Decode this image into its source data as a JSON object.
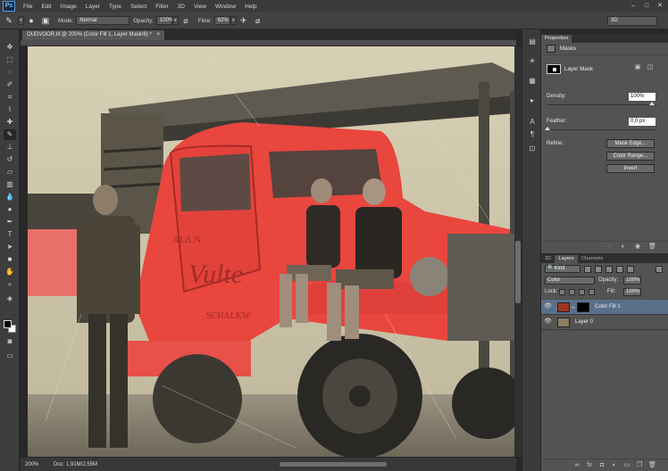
{
  "menubar": {
    "logo": "Ps",
    "items": [
      "File",
      "Edit",
      "Image",
      "Layer",
      "Type",
      "Select",
      "Filter",
      "3D",
      "View",
      "Window",
      "Help"
    ],
    "window_controls": [
      "–",
      "□",
      "✕"
    ]
  },
  "options_bar": {
    "mode_label": "Mode:",
    "mode_value": "Normal",
    "opacity_label": "Opacity:",
    "opacity_value": "100%",
    "flow_label": "Flow:",
    "flow_value": "62%",
    "workspace": "3D"
  },
  "document": {
    "tab_title": "OUDVOOR.tif @ 200% (Color Fill 1, Layer Mask/8) *",
    "tab_close": "×",
    "truck_lettering_1": "ΑΙ.Δ.Ν",
    "truck_lettering_2": "Vulte",
    "truck_lettering_3": "SCHALKW"
  },
  "status": {
    "zoom": "200%",
    "doc_info": "Doc: 1,91M/2,55M"
  },
  "properties_panel": {
    "tab": "Properties",
    "section": "Masks",
    "mask_type": "Layer Mask",
    "density_label": "Density:",
    "density_value": "100%",
    "feather_label": "Feather:",
    "feather_value": "0,0 px",
    "refine_label": "Refine:",
    "buttons": [
      "Mask Edge...",
      "Color Range...",
      "Invert"
    ]
  },
  "layers_panel": {
    "tabs": [
      "3D",
      "Layers",
      "Channels"
    ],
    "kind_filter": "Kind",
    "blend_mode": "Color",
    "opacity_label": "Opacity:",
    "opacity_value": "100%",
    "lock_label": "Lock:",
    "fill_label": "Fill:",
    "fill_value": "100%",
    "layers": [
      {
        "name": "Color Fill 1",
        "selected": true
      },
      {
        "name": "Layer 0",
        "selected": false
      }
    ]
  },
  "colors": {
    "fill_swatch": "#a0341f",
    "accent_blue": "#5a6f8a"
  }
}
